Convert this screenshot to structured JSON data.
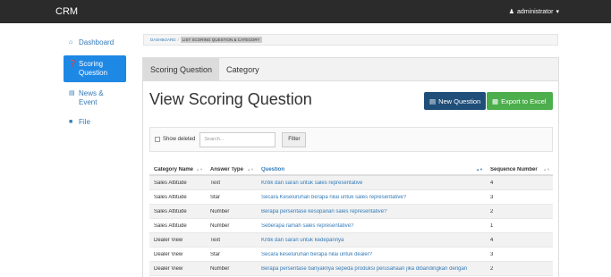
{
  "nav": {
    "brand": "CRM",
    "user": "administrator"
  },
  "sidebar": {
    "items": [
      {
        "label": "Dashboard",
        "icon": "home-icon"
      },
      {
        "label": "Scoring Question",
        "icon": "question-icon"
      },
      {
        "label": "News & Event",
        "icon": "news-icon"
      },
      {
        "label": "File",
        "icon": "folder-icon"
      }
    ]
  },
  "breadcrumb": {
    "home": "DASHBOARD",
    "current": "LIST SCORING QUESTION & CATEGORY"
  },
  "tabs": [
    "Scoring Question",
    "Category"
  ],
  "main": {
    "title": "View Scoring Question",
    "new_button": "New Question",
    "excel_button": "Export to Excel"
  },
  "filter": {
    "show_deleted": "Show deleted",
    "search_placeholder": "Search...",
    "filter_button": "Filter"
  },
  "table": {
    "headers": [
      "Category Name",
      "Answer Type",
      "Question",
      "Sequence Number"
    ],
    "rows": [
      [
        "Sales Attitude",
        "Text",
        "Kritik dan saran untuk sales representative",
        "4"
      ],
      [
        "Sales Attitude",
        "Star",
        "Secara Keseluruhan berapa nilai untuk sales representative?",
        "3"
      ],
      [
        "Sales Attitude",
        "Number",
        "Berapa persentase kesopanan sales representative?",
        "2"
      ],
      [
        "Sales Attitude",
        "Number",
        "Seberapa ramah sales representative?",
        "1"
      ],
      [
        "Dealer View",
        "Text",
        "Kritik dan saran untuk kedepannya",
        "4"
      ],
      [
        "Dealer View",
        "Star",
        "Secara keseluruhan berapa nilai untuk dealer?",
        "3"
      ],
      [
        "Dealer View",
        "Number",
        "Berapa persentase banyaknya sepeda produksi perusahaan jika dibandingkan dengan",
        "2"
      ]
    ]
  },
  "colors": {
    "navbar": "#2b2b2b",
    "active": "#1e88e5",
    "new_button": "#1f4e79",
    "excel_button": "#4cae4c",
    "link": "#337ab7"
  }
}
